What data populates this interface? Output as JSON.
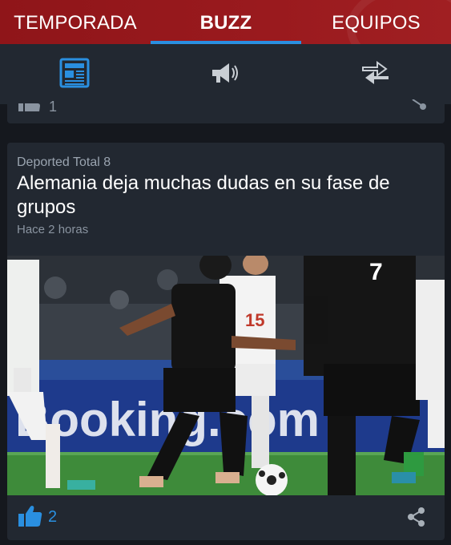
{
  "tabs": [
    {
      "label": "TEMPORADA",
      "active": false
    },
    {
      "label": "BUZZ",
      "active": true
    },
    {
      "label": "EQUIPOS",
      "active": false
    }
  ],
  "subnav": {
    "icons": [
      "newspaper-icon",
      "megaphone-icon",
      "swap-arrows-icon"
    ],
    "active_icon": "newspaper-icon"
  },
  "previous_card": {
    "likes": "1"
  },
  "article": {
    "source": "Deported Total 8",
    "headline": "Alemania deja muchas dudas en su fase de grupos",
    "time": "Hace 2 horas",
    "likes": "2",
    "photo_ad_text": "Booking.com",
    "jersey_numbers": [
      "7",
      "15",
      "7"
    ]
  },
  "colors": {
    "topbar": "#9a1a1e",
    "accent": "#2a8fe0",
    "background": "#15181e",
    "card": "#222831",
    "subbar": "#222831"
  }
}
